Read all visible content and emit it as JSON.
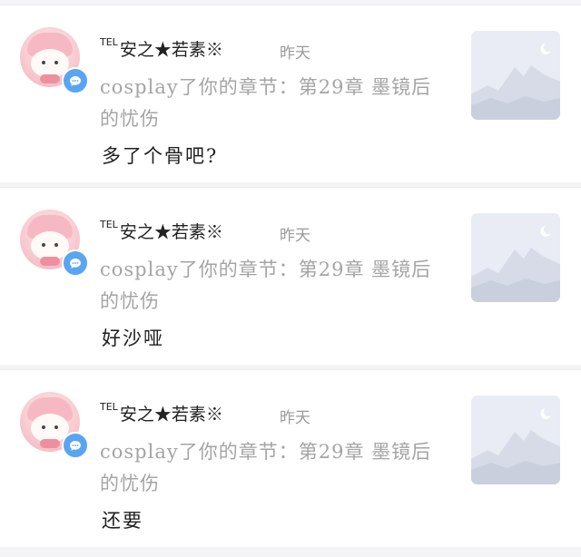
{
  "notifications": [
    {
      "user_prefix": "TEL",
      "user_name": "安之★若素※",
      "time": "昨天",
      "message": "cosplay了你的章节：第29章 墨镜后的忧伤",
      "reply": "多了个骨吧?"
    },
    {
      "user_prefix": "TEL",
      "user_name": "安之★若素※",
      "time": "昨天",
      "message": "cosplay了你的章节：第29章 墨镜后的忧伤",
      "reply": "好沙哑"
    },
    {
      "user_prefix": "TEL",
      "user_name": "安之★若素※",
      "time": "昨天",
      "message": "cosplay了你的章节：第29章 墨镜后的忧伤",
      "reply": "还要"
    }
  ],
  "icons": {
    "badge": "chat-bubble-icon",
    "thumbnail": "image-placeholder-icon"
  },
  "colors": {
    "badge": "#5aa5f2",
    "muted_text": "#a4a4a4",
    "thumbnail_bg": "#e9ecf4"
  }
}
